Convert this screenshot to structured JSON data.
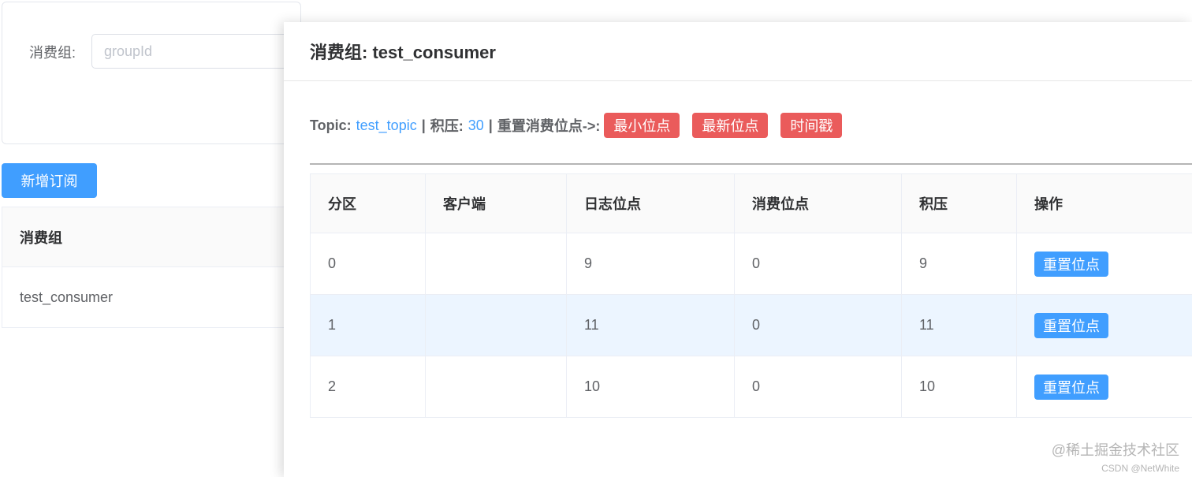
{
  "search": {
    "label": "消费组:",
    "placeholder": "groupId",
    "value": ""
  },
  "add_button_label": "新增订阅",
  "group_list": {
    "header": "消费组",
    "rows": [
      "test_consumer"
    ]
  },
  "dialog": {
    "title": "消费组: test_consumer",
    "topic_label": "Topic:",
    "topic_value": "test_topic",
    "separator": "|",
    "backlog_label": "积压:",
    "backlog_value": "30",
    "reset_label": "重置消费位点->:",
    "reset_buttons": [
      "最小位点",
      "最新位点",
      "时间戳"
    ],
    "table": {
      "columns": [
        "分区",
        "客户端",
        "日志位点",
        "消费位点",
        "积压",
        "操作"
      ],
      "rows": [
        {
          "partition": "0",
          "client": "",
          "log_offset": "9",
          "consumer_offset": "0",
          "backlog": "9",
          "action": "重置位点"
        },
        {
          "partition": "1",
          "client": "",
          "log_offset": "11",
          "consumer_offset": "0",
          "backlog": "11",
          "action": "重置位点"
        },
        {
          "partition": "2",
          "client": "",
          "log_offset": "10",
          "consumer_offset": "0",
          "backlog": "10",
          "action": "重置位点"
        }
      ],
      "highlighted_row": 1
    }
  },
  "watermark": {
    "main": "@稀土掘金技术社区",
    "sub": "CSDN @NetWhite"
  },
  "colors": {
    "primary": "#409eff",
    "danger": "#ea5b5b",
    "row_highlight": "#ecf5ff"
  }
}
